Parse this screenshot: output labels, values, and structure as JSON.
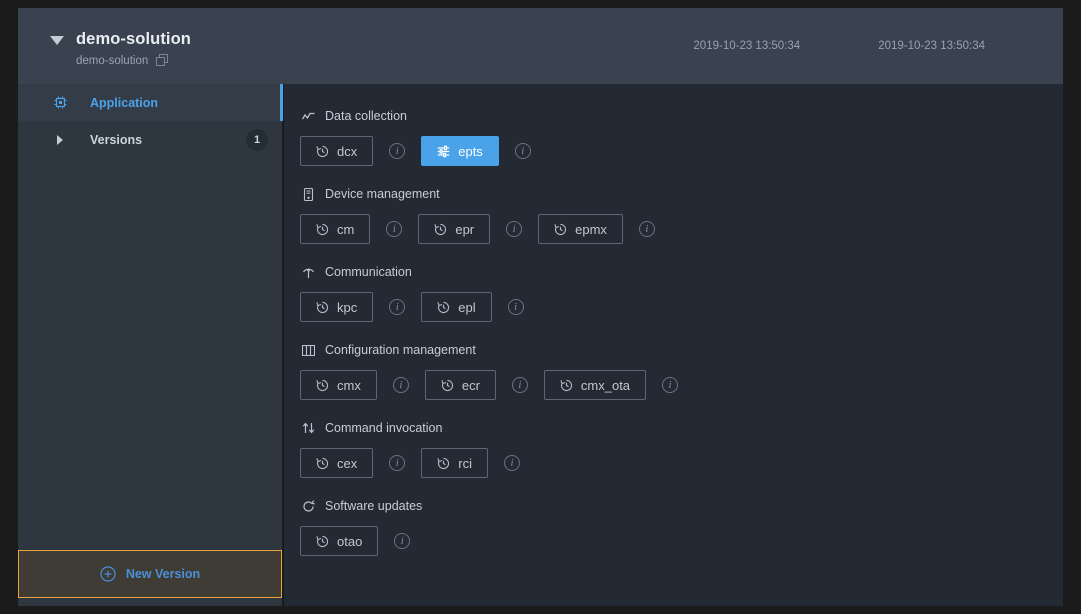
{
  "header": {
    "title": "demo-solution",
    "subtitle": "demo-solution",
    "caret_icon": "caret-down-icon",
    "copy_icon": "copy-icon",
    "timestamp_created": "2019-10-23 13:50:34",
    "timestamp_modified": "2019-10-23 13:50:34"
  },
  "sidebar": {
    "items": [
      {
        "label": "Application",
        "icon": "chip-icon",
        "active": true,
        "badge": null
      },
      {
        "label": "Versions",
        "icon": "caret-right-icon",
        "active": false,
        "badge": "1"
      }
    ],
    "new_version": {
      "label": "New Version",
      "icon": "plus-circle-icon"
    }
  },
  "content": {
    "sections": [
      {
        "title": "Data collection",
        "icon": "line-chart-icon",
        "chips": [
          {
            "label": "dcx",
            "icon": "history-icon",
            "primary": false,
            "info": "i"
          },
          {
            "label": "epts",
            "icon": "sliders-icon",
            "primary": true,
            "info": "i"
          }
        ]
      },
      {
        "title": "Device management",
        "icon": "device-icon",
        "chips": [
          {
            "label": "cm",
            "icon": "history-icon",
            "primary": false,
            "info": "i"
          },
          {
            "label": "epr",
            "icon": "history-icon",
            "primary": false,
            "info": "i"
          },
          {
            "label": "epmx",
            "icon": "history-icon",
            "primary": false,
            "info": "i"
          }
        ]
      },
      {
        "title": "Communication",
        "icon": "antenna-icon",
        "chips": [
          {
            "label": "kpc",
            "icon": "history-icon",
            "primary": false,
            "info": "i"
          },
          {
            "label": "epl",
            "icon": "history-icon",
            "primary": false,
            "info": "i"
          }
        ]
      },
      {
        "title": "Configuration management",
        "icon": "layout-panel-icon",
        "chips": [
          {
            "label": "cmx",
            "icon": "history-icon",
            "primary": false,
            "info": "i"
          },
          {
            "label": "ecr",
            "icon": "history-icon",
            "primary": false,
            "info": "i"
          },
          {
            "label": "cmx_ota",
            "icon": "history-icon",
            "primary": false,
            "info": "i"
          }
        ]
      },
      {
        "title": "Command invocation",
        "icon": "exchange-arrows-icon",
        "chips": [
          {
            "label": "cex",
            "icon": "history-icon",
            "primary": false,
            "info": "i"
          },
          {
            "label": "rci",
            "icon": "history-icon",
            "primary": false,
            "info": "i"
          }
        ]
      },
      {
        "title": "Software updates",
        "icon": "sync-icon",
        "chips": [
          {
            "label": "otao",
            "icon": "history-icon",
            "primary": false,
            "info": "i"
          }
        ]
      }
    ]
  },
  "colors": {
    "accent_blue": "#4aa3e8",
    "accent_orange": "#e9a13b",
    "header_bg": "#39424e",
    "sidebar_bg": "#2e3640",
    "content_bg": "#242a33",
    "page_bg": "#1b1b1b"
  }
}
